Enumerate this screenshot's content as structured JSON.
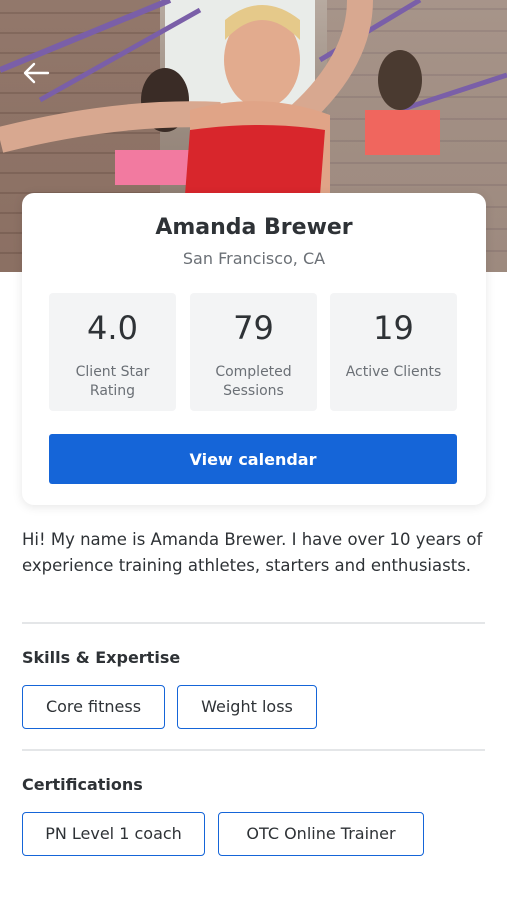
{
  "profile": {
    "name": "Amanda Brewer",
    "location": "San Francisco, CA"
  },
  "stats": [
    {
      "value": "4.0",
      "label": "Client Star Rating"
    },
    {
      "value": "79",
      "label": "Completed Sessions"
    },
    {
      "value": "19",
      "label": "Active Clients"
    }
  ],
  "calendar_button": "View calendar",
  "bio": "Hi! My name is Amanda Brewer. I have over 10 years of experience training athletes, starters and enthusiasts.",
  "skills": {
    "title": "Skills & Expertise",
    "items": [
      "Core fitness",
      "Weight loss"
    ]
  },
  "certifications": {
    "title": "Certifications",
    "items": [
      "PN Level 1 coach",
      "OTC Online Trainer"
    ]
  },
  "colors": {
    "accent": "#1565d8",
    "stat_bg": "#f3f4f5",
    "text": "#2e3236",
    "muted": "#6b7076"
  },
  "icons": {
    "back": "arrow-left-icon"
  }
}
